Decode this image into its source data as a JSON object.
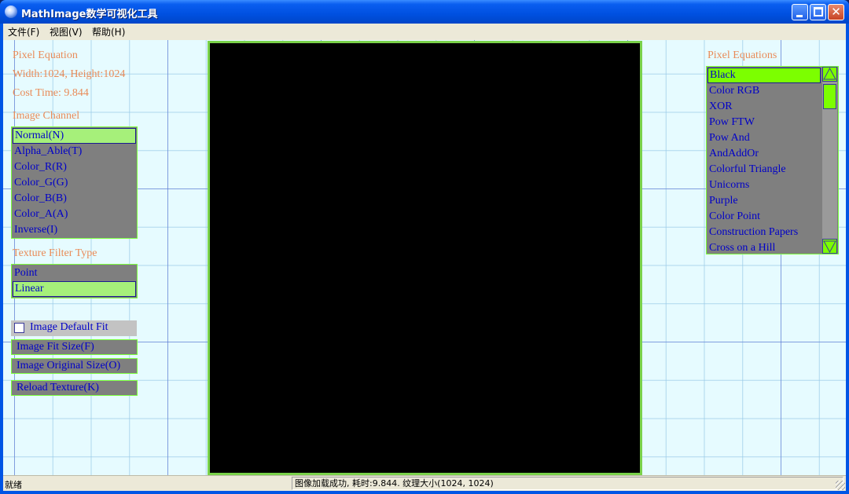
{
  "window": {
    "title": "MathImage数学可视化工具",
    "close_glyph": "✕"
  },
  "menubar": {
    "items": [
      "文件(F)",
      "视图(V)",
      "帮助(H)"
    ]
  },
  "left_panel": {
    "pixel_equation_label": "Pixel Equation",
    "size_label": "Width:1024, Height:1024",
    "cost_time_label": "Cost Time: 9.844",
    "image_channel_label": "Image Channel",
    "channels": [
      "Normal(N)",
      "Alpha_Able(T)",
      "Color_R(R)",
      "Color_G(G)",
      "Color_B(B)",
      "Color_A(A)",
      "Inverse(I)"
    ],
    "texture_filter_label": "Texture Filter Type",
    "filters": [
      "Point",
      "Linear"
    ],
    "default_fit_label": "Image Default Fit",
    "fit_size_button": "Image Fit Size(F)",
    "original_size_button": "Image Original Size(O)",
    "reload_button": "Reload Texture(K)"
  },
  "right_panel": {
    "pixel_equations_label": "Pixel Equations",
    "equations": [
      "Black",
      "Color RGB",
      "XOR",
      "Pow FTW",
      "Pow And",
      "AndAddOr",
      "Colorful Triangle",
      "Unicorns",
      "Purple",
      "Color Point",
      "Construction Papers",
      "Cross on a Hill"
    ]
  },
  "statusbar": {
    "left": "就绪",
    "right": "图像加载成功, 耗时:9.844. 纹理大小(1024, 1024)"
  },
  "colors": {
    "label": "#e98b58",
    "item_text": "#0000c8",
    "selected": "#a6f07a",
    "accent_green": "#7cff00"
  }
}
